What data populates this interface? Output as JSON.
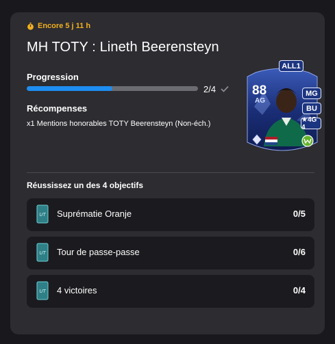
{
  "header": {
    "timer_text": "Encore 5 j 11 h",
    "title": "MH TOTY : Lineth Beerensteyn"
  },
  "progress": {
    "label": "Progression",
    "current": 2,
    "total": 4,
    "count_text": "2/4",
    "fraction": 0.5
  },
  "rewards": {
    "label": "Récompenses",
    "items": [
      "x1 Mentions honorables TOTY Beerensteyn (Non-éch.)"
    ]
  },
  "card": {
    "badge": "ALL1",
    "rating": "88",
    "position": "AG",
    "alt_positions": [
      "MG",
      "BU"
    ],
    "skills_text": "★4G 4"
  },
  "objectives": {
    "label": "Réussissez un des 4 objectifs",
    "items": [
      {
        "label": "Suprématie Oranje",
        "count": "0/5"
      },
      {
        "label": "Tour de passe-passe",
        "count": "0/6"
      },
      {
        "label": "4 victoires",
        "count": "0/4"
      }
    ]
  },
  "colors": {
    "background": "#19191d",
    "panel": "#2c2c31",
    "timer_accent": "#f2b01e",
    "progress_fill": "#1e8ef0",
    "progress_track": "#6b6b72",
    "objective_row": "#1b1b1f",
    "card_base": "#1b2f78"
  },
  "icons": {
    "timer": "stopwatch-icon",
    "complete": "check-icon",
    "objective": "ut-pack-icon",
    "nation": "netherlands-flag-icon",
    "club": "wolfsburg-crest-icon",
    "league": "league-logo-icon"
  }
}
